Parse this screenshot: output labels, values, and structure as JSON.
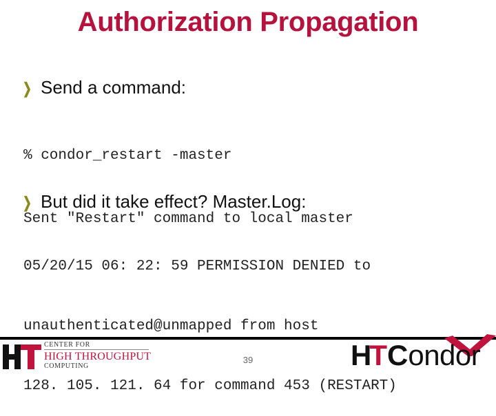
{
  "slide": {
    "title": "Authorization Propagation",
    "page_number": "39",
    "accent_color": "#b5123e",
    "bullet_color": "#8a8a1e"
  },
  "bullets": [
    {
      "icon": "chevron-right-icon",
      "label": "Send a command:",
      "code_lines": [
        "% condor_restart -master",
        "Sent \"Restart\" command to local master"
      ]
    },
    {
      "icon": "chevron-right-icon",
      "label": "But did it take effect?  Master.Log:",
      "code_lines": [
        "05/20/15 06: 22: 59 PERMISSION DENIED to",
        "unauthenticated@unmapped from host",
        "128. 105. 121. 64 for command 453 (RESTART)"
      ]
    }
  ],
  "footer": {
    "chtc_logo": {
      "mark": "HT",
      "line1": "CENTER FOR",
      "line2": "HIGH THROUGHPUT",
      "line3": "COMPUTING"
    },
    "htcondor_logo": {
      "h": "H",
      "t": "T",
      "c": "C",
      "rest": "ondor"
    }
  }
}
